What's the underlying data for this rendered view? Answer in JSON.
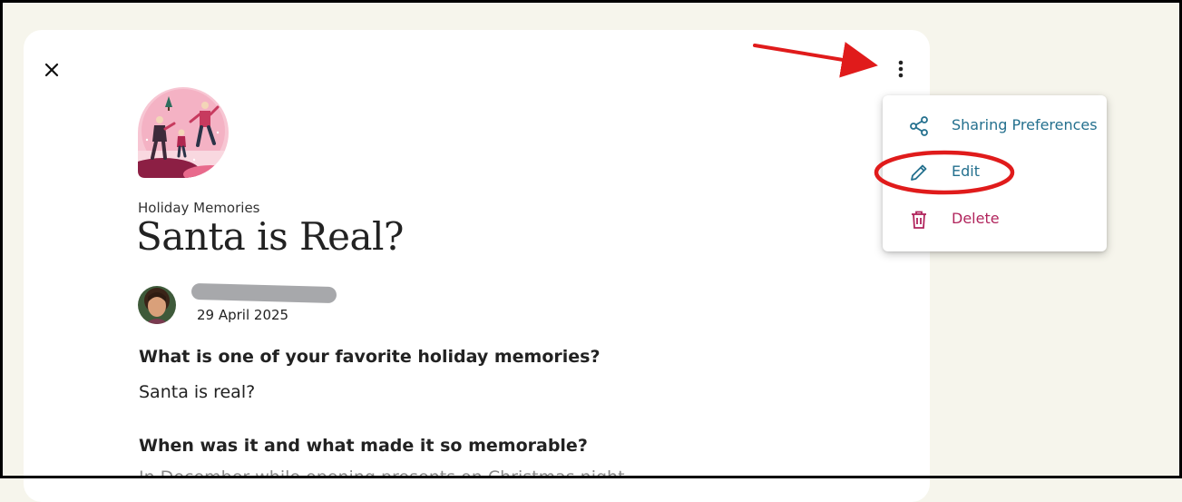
{
  "story": {
    "category": "Holiday Memories",
    "title": "Santa is Real?",
    "date": "29 April 2025",
    "sections": [
      {
        "question": "What is one of your favorite holiday memories?",
        "answer": "Santa is real?"
      },
      {
        "question": "When was it and what made it so memorable?",
        "answer": "In December while opening presents on Christmas night …"
      }
    ]
  },
  "menu": {
    "items": [
      {
        "label": "Sharing Preferences",
        "icon": "share-icon",
        "color": "#24708e"
      },
      {
        "label": "Edit",
        "icon": "pencil-icon",
        "color": "#24708e"
      },
      {
        "label": "Delete",
        "icon": "trash-icon",
        "color": "#b1245c"
      }
    ]
  },
  "colors": {
    "page_background": "#f6f5ec",
    "card_background": "#ffffff",
    "accent_teal": "#24708e",
    "danger": "#b1245c",
    "annotation_red": "#e01b1b",
    "redaction_gray": "#a7a8ab"
  }
}
